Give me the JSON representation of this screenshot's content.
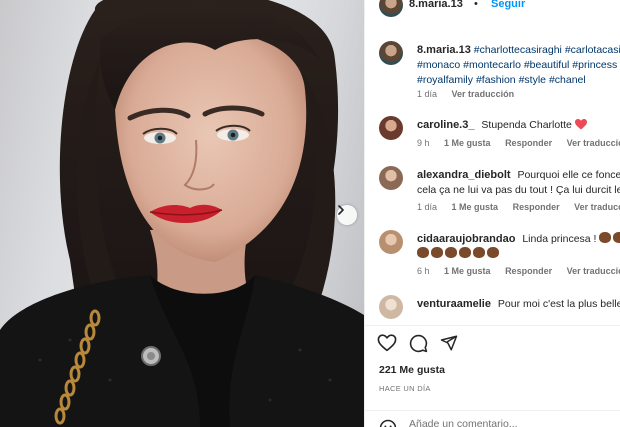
{
  "post": {
    "username": "8.maria.13",
    "separator": "•",
    "follow_label": "Seguir",
    "carousel_next": "next-arrow"
  },
  "caption": {
    "username": "8.maria.13",
    "lines": [
      [
        "#charlottecasiraghi",
        "#carlotacasira"
      ],
      [
        "#monaco",
        "#montecarlo",
        "#beautiful",
        "#princess"
      ],
      [
        "#royalfamily",
        "#fashion",
        "#style",
        "#chanel"
      ]
    ],
    "time": "1 día",
    "translate": "Ver traducción"
  },
  "comments": [
    {
      "username": "caroline.3_",
      "text": "Stupenda Charlotte",
      "emoji": "red-heart",
      "time": "9 h",
      "likes": "1 Me gusta",
      "reply": "Responder",
      "translate": "Ver traducción",
      "avatar_color": "#9a5b4c"
    },
    {
      "username": "alexandra_diebolt",
      "text": "Pourquoi elle ce fonce le",
      "text2": "cela ça ne lui va pas du tout ! Ça lui durcit le",
      "time": "1 día",
      "likes": "1 Me gusta",
      "reply": "Responder",
      "translate": "Ver traducción",
      "avatar_color": "#b88a6e"
    },
    {
      "username": "cidaaraujobrandao",
      "text": "Linda princesa !",
      "time": "6 h",
      "likes": "1 Me gusta",
      "reply": "Responder",
      "translate": "Ver traducción",
      "avatar_color": "#c9a07e"
    },
    {
      "username": "venturaamelie",
      "text": "Pour moi c'est la plus belle",
      "avatar_color": "#d8c3b0"
    }
  ],
  "actions": {
    "likes": "221 Me gusta",
    "posted": "HACE UN DÍA",
    "comment_placeholder": "Añade un comentario..."
  },
  "colors": {
    "link": "#00376b",
    "follow": "#0095f6",
    "meta": "#737373",
    "heart": "#ed4956"
  }
}
